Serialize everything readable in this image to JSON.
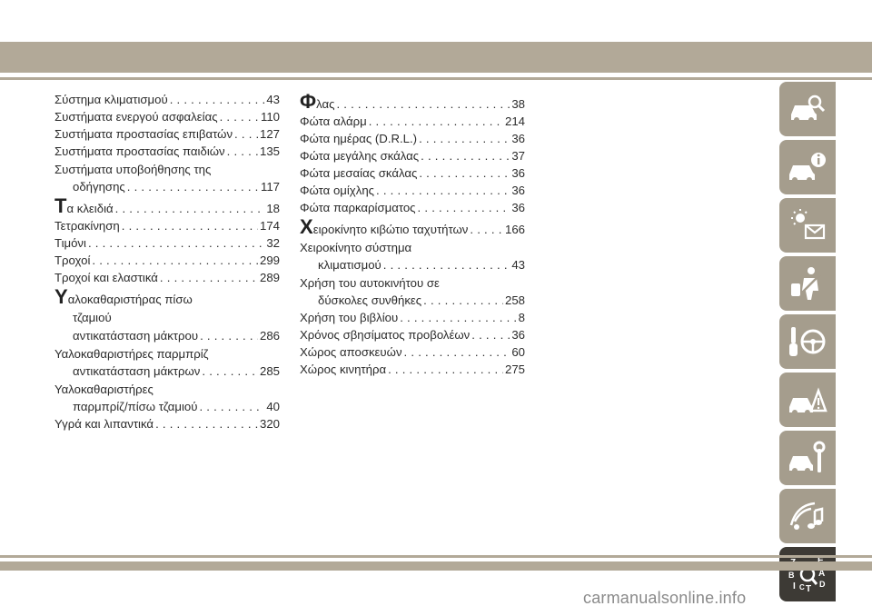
{
  "left_column": [
    {
      "type": "entry",
      "lines": [
        "Σύστημα κλιματισμού"
      ],
      "page": "43"
    },
    {
      "type": "entry",
      "lines": [
        "Συστήματα ενεργού ασφαλείας"
      ],
      "page": "110"
    },
    {
      "type": "entry",
      "lines": [
        "Συστήματα προστασίας επιβατών"
      ],
      "page": "127"
    },
    {
      "type": "entry",
      "lines": [
        "Συστήματα προστασίας παιδιών"
      ],
      "page": "135"
    },
    {
      "type": "entry",
      "lines": [
        "Συστήματα υποβοήθησης της",
        "οδήγησης"
      ],
      "page": "117"
    },
    {
      "type": "head",
      "letter": "Τ",
      "text": "α κλειδιά",
      "page": "18"
    },
    {
      "type": "entry",
      "lines": [
        "Τετρακίνηση"
      ],
      "page": "174"
    },
    {
      "type": "entry",
      "lines": [
        "Τιμόνι"
      ],
      "page": "32"
    },
    {
      "type": "entry",
      "lines": [
        "Τροχοί"
      ],
      "page": "299"
    },
    {
      "type": "entry",
      "lines": [
        "Τροχοί και ελαστικά"
      ],
      "page": "289"
    },
    {
      "type": "head",
      "letter": "Υ",
      "text": "αλοκαθαριστήρας πίσω",
      "page": ""
    },
    {
      "type": "plain",
      "text": "τζαμιού"
    },
    {
      "type": "entry",
      "lines": [
        "αντικατάσταση μάκτρου"
      ],
      "page": "286",
      "indented": true
    },
    {
      "type": "entry",
      "lines": [
        "Υαλοκαθαριστήρες παρμπρίζ",
        "αντικατάσταση μάκτρων"
      ],
      "page": "285"
    },
    {
      "type": "entry",
      "lines": [
        "Υαλοκαθαριστήρες",
        "παρμπρίζ/πίσω τζαμιού"
      ],
      "page": "40"
    },
    {
      "type": "entry",
      "lines": [
        "Υγρά και λιπαντικά"
      ],
      "page": "320"
    }
  ],
  "right_column": [
    {
      "type": "head",
      "letter": "Φ",
      "text": "λας",
      "page": "38"
    },
    {
      "type": "entry",
      "lines": [
        "Φώτα αλάρμ"
      ],
      "page": "214"
    },
    {
      "type": "entry",
      "lines": [
        "Φώτα ημέρας (D.R.L.)"
      ],
      "page": "36"
    },
    {
      "type": "entry",
      "lines": [
        "Φώτα μεγάλης σκάλας"
      ],
      "page": "37"
    },
    {
      "type": "entry",
      "lines": [
        "Φώτα μεσαίας σκάλας"
      ],
      "page": "36"
    },
    {
      "type": "entry",
      "lines": [
        "Φώτα ομίχλης"
      ],
      "page": "36"
    },
    {
      "type": "entry",
      "lines": [
        "Φώτα παρκαρίσματος"
      ],
      "page": "36"
    },
    {
      "type": "head",
      "letter": "Χ",
      "text": "ειροκίνητο κιβώτιο ταχυτήτων",
      "page": "166"
    },
    {
      "type": "entry",
      "lines": [
        "Χειροκίνητο σύστημα",
        "κλιματισμού"
      ],
      "page": "43"
    },
    {
      "type": "entry",
      "lines": [
        "Χρήση του αυτοκινήτου σε",
        "δύσκολες συνθήκες"
      ],
      "page": "258"
    },
    {
      "type": "entry",
      "lines": [
        "Χρήση του βιβλίου"
      ],
      "page": "8"
    },
    {
      "type": "entry",
      "lines": [
        "Χρόνος σβησίματος προβολέων"
      ],
      "page": "36"
    },
    {
      "type": "entry",
      "lines": [
        "Χώρος αποσκευών"
      ],
      "page": "60"
    },
    {
      "type": "entry",
      "lines": [
        "Χώρος κινητήρα"
      ],
      "page": "275"
    }
  ],
  "sidebar_tabs": [
    {
      "icon": "car-search-icon",
      "active": false
    },
    {
      "icon": "car-info-icon",
      "active": false
    },
    {
      "icon": "warning-lights-icon",
      "active": false
    },
    {
      "icon": "safety-person-icon",
      "active": false
    },
    {
      "icon": "key-steering-icon",
      "active": false
    },
    {
      "icon": "roadside-warning-icon",
      "active": false
    },
    {
      "icon": "car-service-icon",
      "active": false
    },
    {
      "icon": "multimedia-icon",
      "active": false
    },
    {
      "icon": "index-letters-icon",
      "active": true
    }
  ],
  "sidebar_index_letters": [
    "Z",
    "E",
    "B",
    "A",
    "I",
    "C",
    "T",
    "D"
  ],
  "watermark": "carmanualsonline.info"
}
